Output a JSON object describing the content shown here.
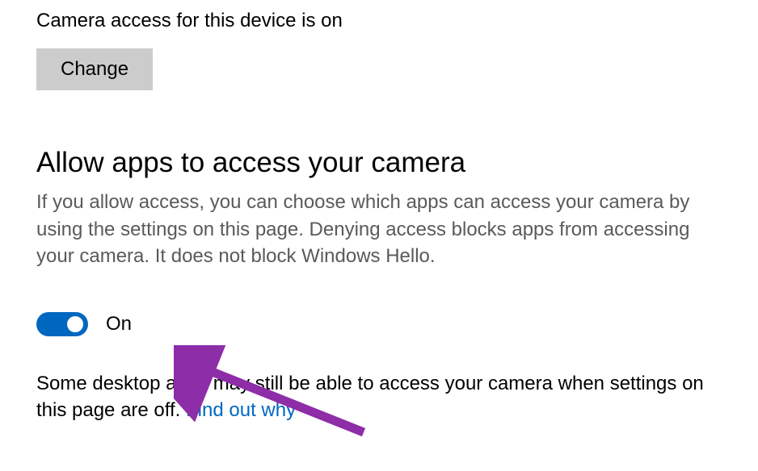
{
  "device_access": {
    "status_text": "Camera access for this device is on",
    "change_label": "Change"
  },
  "allow_apps": {
    "heading": "Allow apps to access your camera",
    "description": "If you allow access, you can choose which apps can access your camera by using the settings on this page. Denying access blocks apps from accessing your camera. It does not block Windows Hello.",
    "toggle_state": "On"
  },
  "footer": {
    "text_start": "Some desktop apps may still be able to access your camera when settings on this page are off. ",
    "link_text": "Find out why"
  },
  "colors": {
    "accent": "#0067c0",
    "button_bg": "#cccccc",
    "text_secondary": "#5a5a5a",
    "arrow": "#8e2da8"
  }
}
